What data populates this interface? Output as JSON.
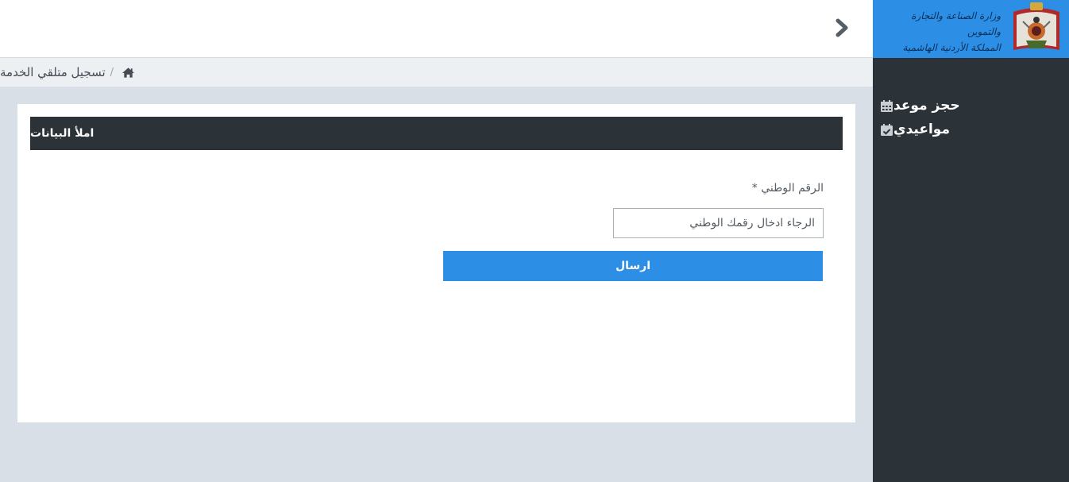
{
  "branding": {
    "ministry_line1": "وزارة الصناعة والتجارة والتموين",
    "ministry_line2": "المملكة الأردنية الهاشمية",
    "emblem_icon": "jordan-coat-of-arms-icon",
    "header_color": "#2d8ee6"
  },
  "sidebar": {
    "items": [
      {
        "label": "حجز موعد",
        "icon": "calendar-icon"
      },
      {
        "label": "مواعيدي",
        "icon": "calendar-check-icon"
      }
    ]
  },
  "topbar": {
    "toggle_icon": "chevron-right-icon"
  },
  "breadcrumb": {
    "home_icon": "home-icon",
    "separator": "/",
    "current": "تسجيل متلقي الخدمة"
  },
  "form": {
    "header": "املأ البيانات",
    "national_id_label": "الرقم الوطني *",
    "national_id_placeholder": "الرجاء ادخال رقمك الوطني",
    "national_id_value": "",
    "submit_label": "ارسال"
  },
  "colors": {
    "primary": "#2d8ee6",
    "dark": "#2b3238",
    "background": "#d9dfe7"
  }
}
